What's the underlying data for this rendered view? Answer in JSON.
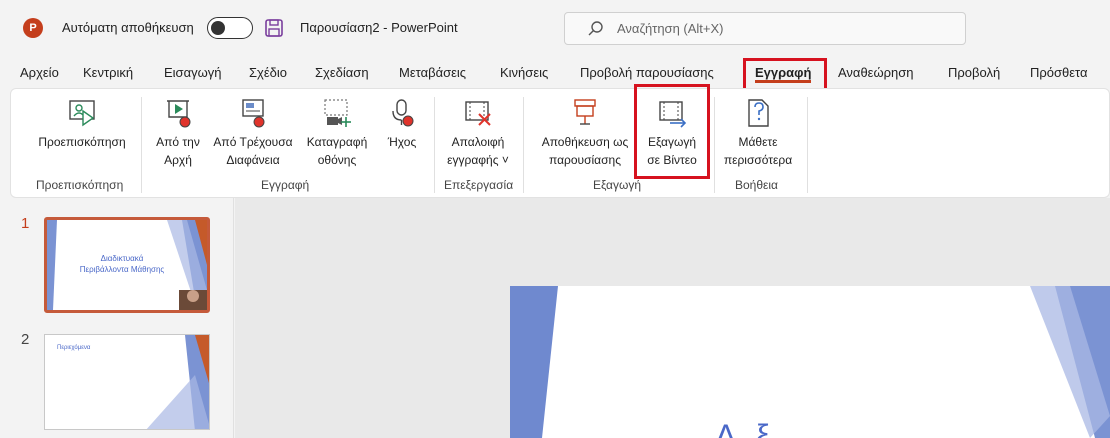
{
  "titlebar": {
    "app_logo": "P",
    "autosave_label": "Αυτόματη αποθήκευση",
    "doc_title": "Παρουσίαση2  -  PowerPoint",
    "search_placeholder": "Αναζήτηση (Alt+X)"
  },
  "tabs": [
    "Αρχείο",
    "Κεντρική",
    "Εισαγωγή",
    "Σχέδιο",
    "Σχεδίαση",
    "Μεταβάσεις",
    "Κινήσεις",
    "Προβολή παρουσίασης",
    "Εγγραφή",
    "Αναθεώρηση",
    "Προβολή",
    "Πρόσθετα"
  ],
  "active_tab": "Εγγραφή",
  "ribbon": {
    "buttons": {
      "preview": [
        "Προεπισκόπηση"
      ],
      "from_start": [
        "Από την",
        "Αρχή"
      ],
      "from_current": [
        "Από Τρέχουσα",
        "Διαφάνεια"
      ],
      "screen_recording": [
        "Καταγραφή",
        "οθόνης"
      ],
      "audio": [
        "Ήχος"
      ],
      "clear_recording": [
        "Απαλοιφή",
        "εγγραφής ˅"
      ],
      "save_as_show": [
        "Αποθήκευση ως",
        "παρουσίασης"
      ],
      "export_video": [
        "Εξαγωγή",
        "σε Βίντεο"
      ],
      "learn_more": [
        "Μάθετε",
        "περισσότερα"
      ]
    },
    "groups": {
      "preview": "Προεπισκόπηση",
      "recording": "Εγγραφή",
      "editing": "Επεξεργασία",
      "export": "Εξαγωγή",
      "help": "Βοήθεια"
    }
  },
  "slides": [
    {
      "number": "1",
      "title_line1": "Διαδικτυακά",
      "title_line2": "Περιβάλλοντα Μάθησης"
    },
    {
      "number": "2",
      "title_line1": "Περιεχόμενα"
    }
  ],
  "main_slide_partial_text": "Δ   ξ",
  "colors": {
    "accent": "#c43e1c",
    "highlight": "#d6121f",
    "record_red": "#e0332b",
    "slide_blue": "#4a68c8",
    "slide_orange": "#c55a2a"
  }
}
